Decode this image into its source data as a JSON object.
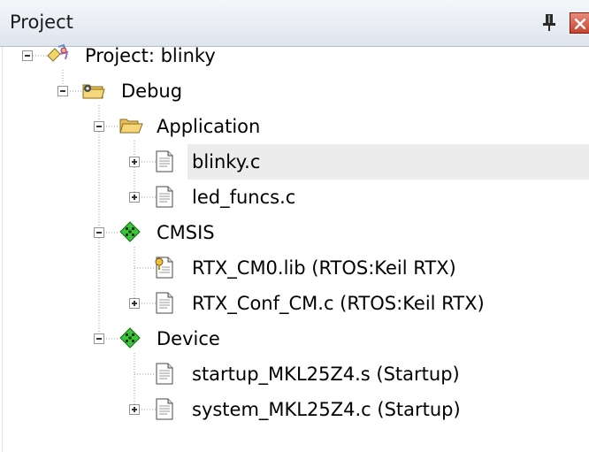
{
  "panel": {
    "title": "Project"
  },
  "tree": {
    "nodes": [
      {
        "label": "Project: blinky",
        "icon": "project-icon",
        "expander": "minus"
      },
      {
        "label": "Debug",
        "icon": "target-folder-icon",
        "expander": "minus"
      },
      {
        "label": "Application",
        "icon": "folder-open-icon",
        "expander": "minus"
      },
      {
        "label": "blinky.c",
        "icon": "source-file-icon",
        "expander": "plus",
        "selected": true
      },
      {
        "label": "led_funcs.c",
        "icon": "source-file-icon",
        "expander": "plus"
      },
      {
        "label": "CMSIS",
        "icon": "component-diamond-icon",
        "expander": "minus"
      },
      {
        "label": "RTX_CM0.lib (RTOS:Keil RTX)",
        "icon": "library-file-icon",
        "expander": "none"
      },
      {
        "label": "RTX_Conf_CM.c (RTOS:Keil RTX)",
        "icon": "source-file-icon",
        "expander": "plus"
      },
      {
        "label": "Device",
        "icon": "component-diamond-icon",
        "expander": "minus"
      },
      {
        "label": "startup_MKL25Z4.s (Startup)",
        "icon": "source-file-icon",
        "expander": "none"
      },
      {
        "label": "system_MKL25Z4.c (Startup)",
        "icon": "source-file-icon",
        "expander": "plus"
      }
    ]
  },
  "colors": {
    "selection": "#ececec",
    "component": "#39c43a",
    "folder": "#e8c15a"
  }
}
